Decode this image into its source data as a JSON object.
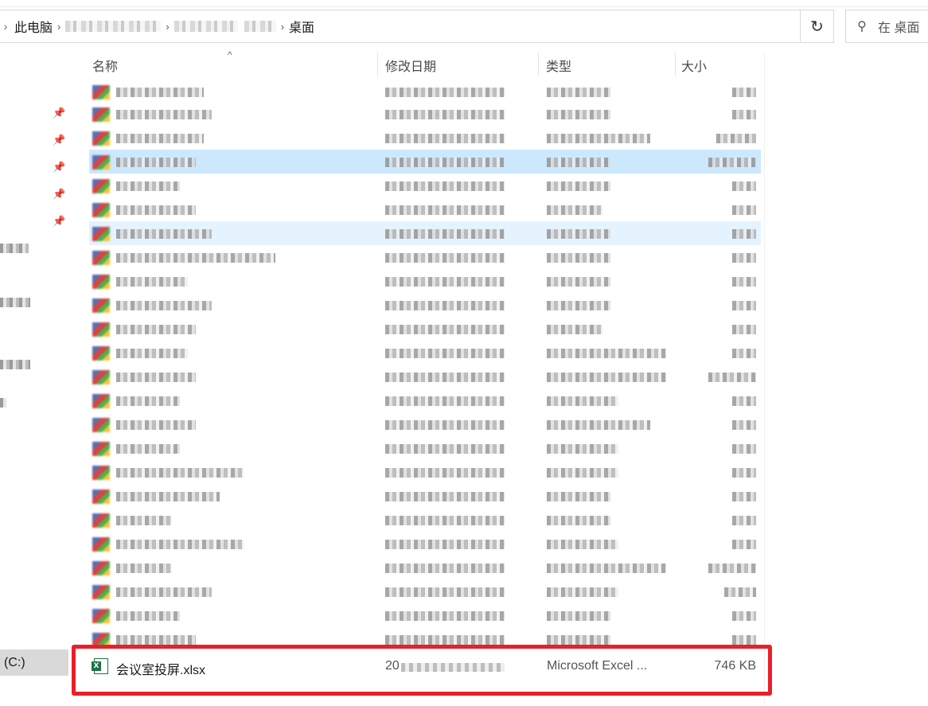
{
  "address_bar": {
    "crumbs": [
      "此电脑",
      "桌面"
    ],
    "separator": "›",
    "dropdown_icon": "chevron-down-icon",
    "refresh_icon": "refresh-icon"
  },
  "search": {
    "placeholder": "在 桌面",
    "icon": "search-icon"
  },
  "nav_pane": {
    "drive_label": "(C:)",
    "pin_icon": "pin-icon"
  },
  "columns": {
    "name": "名称",
    "date": "修改日期",
    "type": "类型",
    "size": "大小"
  },
  "highlighted_file": {
    "name": "会议室投屏.xlsx",
    "date_prefix": "20",
    "type": "Microsoft Excel ...",
    "size": "746 KB",
    "icon": "excel-file-icon"
  },
  "colors": {
    "highlight_border": "#e8202a",
    "selected_row": "#cce8ff",
    "hover_row": "#e5f3ff"
  }
}
